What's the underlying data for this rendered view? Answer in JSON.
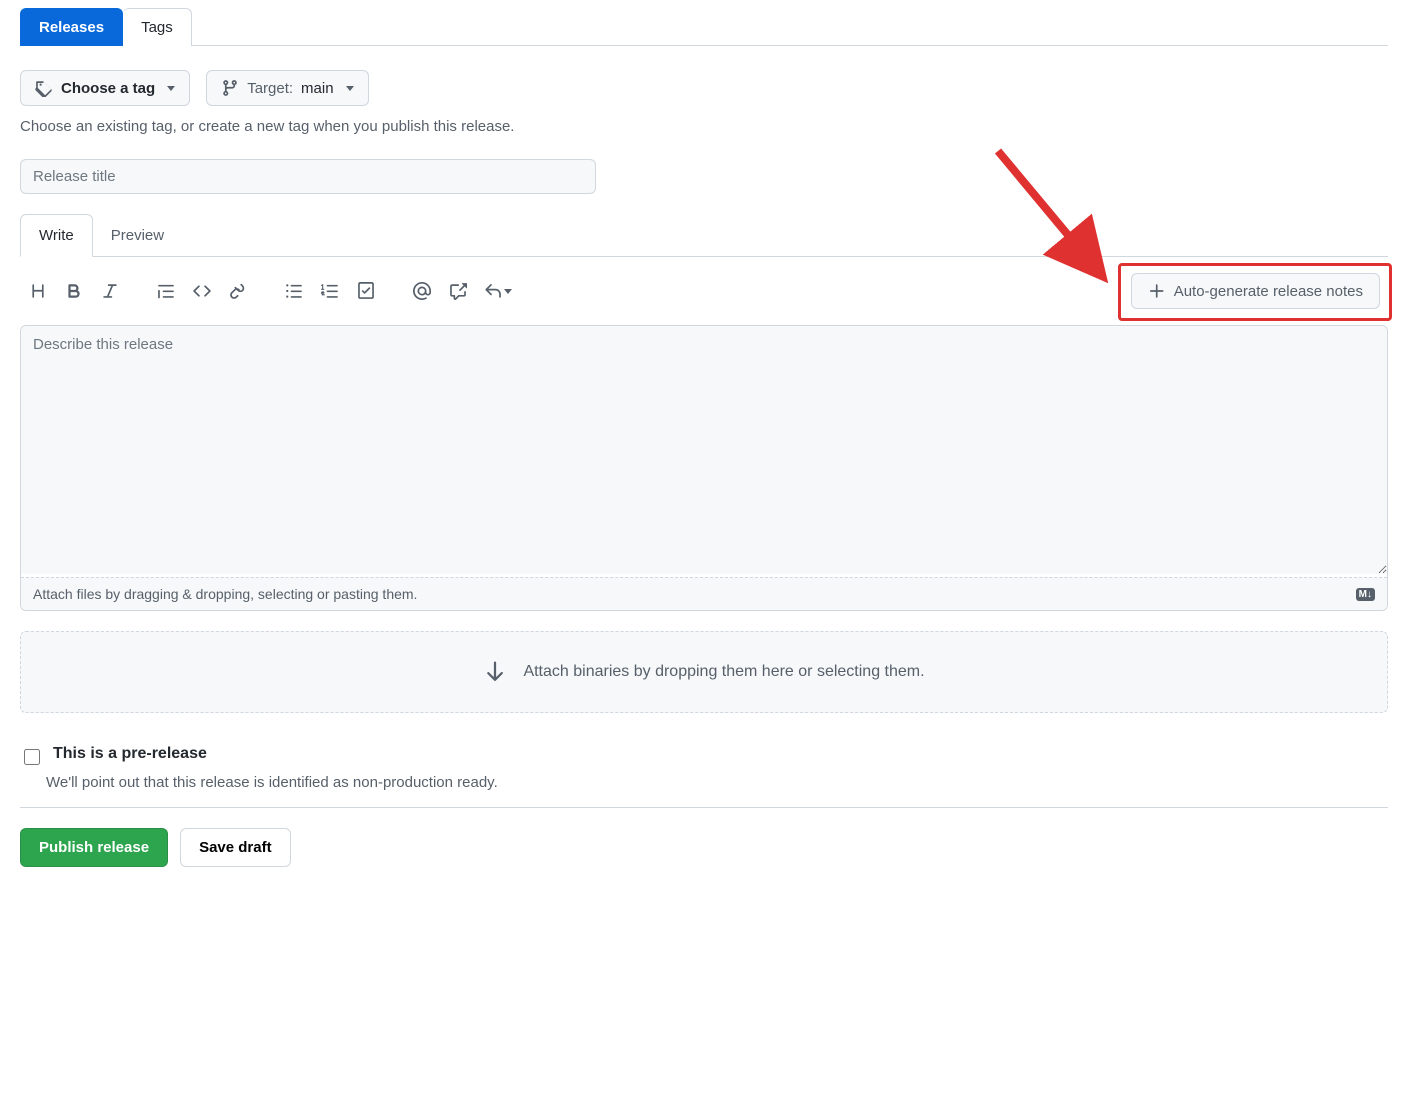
{
  "topTabs": {
    "releases": "Releases",
    "tags": "Tags"
  },
  "tagSelector": {
    "choose": "Choose a tag",
    "targetLabel": "Target:",
    "targetValue": "main"
  },
  "tagHint": "Choose an existing tag, or create a new tag when you publish this release.",
  "titleInput": {
    "placeholder": "Release title",
    "value": ""
  },
  "editorTabs": {
    "write": "Write",
    "preview": "Preview"
  },
  "autoGen": "Auto-generate release notes",
  "description": {
    "placeholder": "Describe this release",
    "value": ""
  },
  "attachHint": "Attach files by dragging & dropping, selecting or pasting them.",
  "mdBadge": "M↓",
  "dropZone": "Attach binaries by dropping them here or selecting them.",
  "prerelease": {
    "label": "This is a pre-release",
    "desc": "We'll point out that this release is identified as non-production ready."
  },
  "buttons": {
    "publish": "Publish release",
    "draft": "Save draft"
  }
}
